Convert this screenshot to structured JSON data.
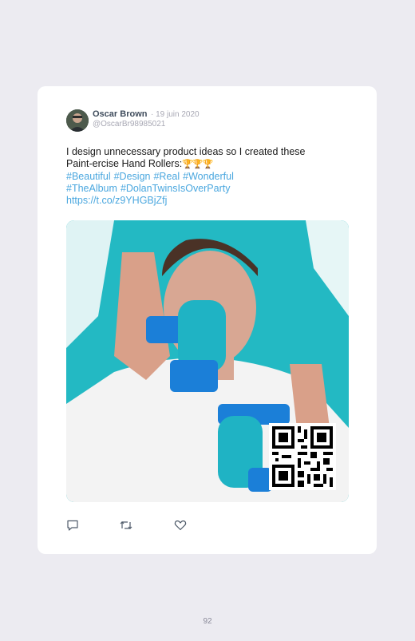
{
  "post": {
    "author_name": "Oscar Brown",
    "date": "· 19 juin 2020",
    "handle": "@OscarBr98985021",
    "text_line1": "I design unnecessary product ideas so I created these",
    "text_line2": "Paint-ercise Hand Rollers:",
    "trophy_emoji": "🏆🏆🏆",
    "hashtags_line1": [
      "#Beautiful",
      "#Design",
      "#Real",
      "#Wonderful"
    ],
    "hashtags_line2": [
      "#TheAlbum",
      "#DolanTwinsIsOverParty"
    ],
    "link": "https://t.co/z9YHGBjZfj",
    "media_icon": "photo-with-paint-rollers",
    "qr_icon": "qr-code-icon"
  },
  "actions": {
    "reply_icon": "reply-icon",
    "retweet_icon": "retweet-icon",
    "like_icon": "heart-icon"
  },
  "page": {
    "number": "92"
  },
  "colors": {
    "background": "#ecebf1",
    "card": "#ffffff",
    "link": "#4aa7df",
    "name": "#3f4c5c",
    "muted": "#a8a8b4"
  }
}
